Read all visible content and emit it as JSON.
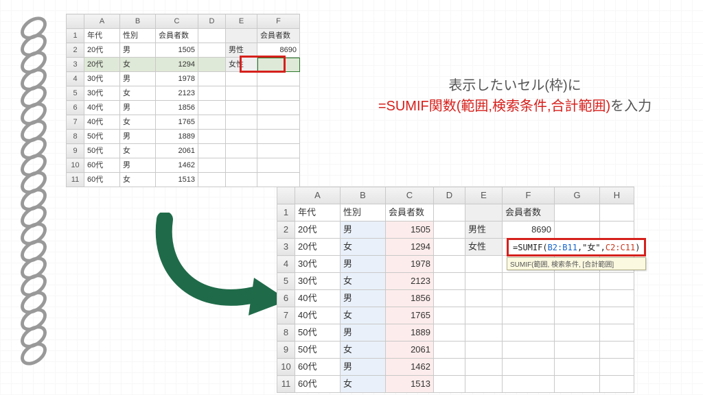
{
  "columns": {
    "A": "A",
    "B": "B",
    "C": "C",
    "D": "D",
    "E": "E",
    "F": "F",
    "G": "G",
    "H": "H"
  },
  "headers": {
    "age": "年代",
    "sex": "性別",
    "members": "会員者数",
    "male": "男性",
    "female": "女性"
  },
  "rows": [
    {
      "n": "1"
    },
    {
      "n": "2",
      "age": "20代",
      "sex": "男",
      "members": "1505"
    },
    {
      "n": "3",
      "age": "20代",
      "sex": "女",
      "members": "1294"
    },
    {
      "n": "4",
      "age": "30代",
      "sex": "男",
      "members": "1978"
    },
    {
      "n": "5",
      "age": "30代",
      "sex": "女",
      "members": "2123"
    },
    {
      "n": "6",
      "age": "40代",
      "sex": "男",
      "members": "1856"
    },
    {
      "n": "7",
      "age": "40代",
      "sex": "女",
      "members": "1765"
    },
    {
      "n": "8",
      "age": "50代",
      "sex": "男",
      "members": "1889"
    },
    {
      "n": "9",
      "age": "50代",
      "sex": "女",
      "members": "2061"
    },
    {
      "n": "10",
      "age": "60代",
      "sex": "男",
      "members": "1462"
    },
    {
      "n": "11",
      "age": "60代",
      "sex": "女",
      "members": "1513"
    }
  ],
  "summary": {
    "male_total": "8690"
  },
  "caption": {
    "line1": "表示したいセル(枠)に",
    "line2_red": "=SUMIF関数(範囲,検索条件,合計範囲)",
    "line2_suffix": "を入力"
  },
  "formula": {
    "prefix": "=SUMIF(",
    "arg1": "B2:B11",
    "sep1": ",",
    "arg2": "\"女\"",
    "sep2": ",",
    "arg3": "C2:C11",
    "suffix": ")"
  },
  "hint": "SUMIF(範囲, 検索条件, [合計範囲]",
  "chart_data": {
    "type": "table",
    "title": "会員者数 by 年代 × 性別",
    "columns": [
      "年代",
      "性別",
      "会員者数"
    ],
    "rows": [
      [
        "20代",
        "男",
        1505
      ],
      [
        "20代",
        "女",
        1294
      ],
      [
        "30代",
        "男",
        1978
      ],
      [
        "30代",
        "女",
        2123
      ],
      [
        "40代",
        "男",
        1856
      ],
      [
        "40代",
        "女",
        1765
      ],
      [
        "50代",
        "男",
        1889
      ],
      [
        "50代",
        "女",
        2061
      ],
      [
        "60代",
        "男",
        1462
      ],
      [
        "60代",
        "女",
        1513
      ]
    ],
    "derived": {
      "SUMIF_性別=男": 8690,
      "SUMIF_formula_for_女": "=SUMIF(B2:B11,\"女\",C2:C11)"
    }
  }
}
